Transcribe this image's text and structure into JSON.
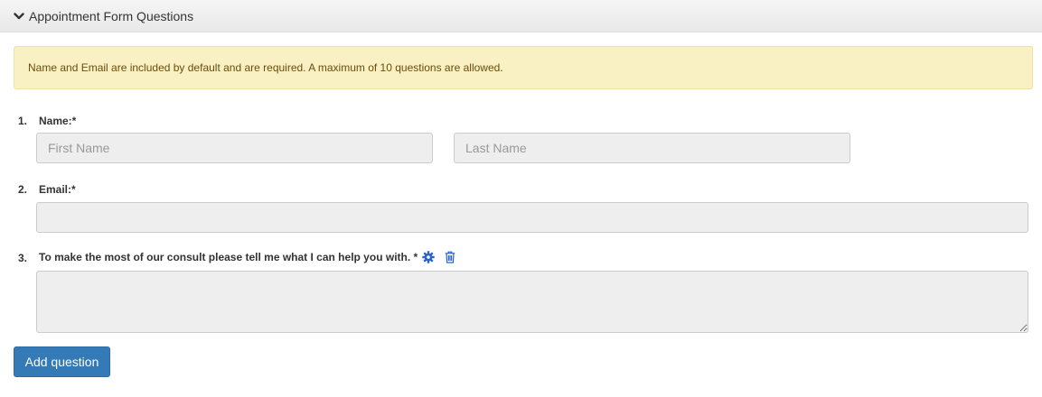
{
  "panel": {
    "title": "Appointment Form Questions",
    "collapse_icon": "chevron-down-icon"
  },
  "notice": {
    "text": "Name and Email are included by default and are required. A maximum of 10 questions are allowed."
  },
  "questions": [
    {
      "number": "1.",
      "label": "Name:*",
      "first_name_placeholder": "First Name",
      "last_name_placeholder": "Last Name",
      "first_name_value": "",
      "last_name_value": ""
    },
    {
      "number": "2.",
      "label": "Email:*",
      "value": ""
    },
    {
      "number": "3.",
      "label": "To make the most of our consult please tell me what I can help you with. *",
      "value": "",
      "settings_icon": "gear-icon",
      "delete_icon": "trash-icon"
    }
  ],
  "actions": {
    "add_question_label": "Add question"
  },
  "colors": {
    "primary": "#337ab7",
    "icon_blue": "#2a63c9",
    "notice_bg": "#f9f0c3",
    "notice_text": "#6b4d08"
  }
}
